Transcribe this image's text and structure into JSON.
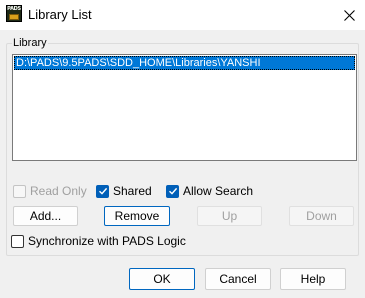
{
  "window": {
    "title": "Library List",
    "icon_text": "PADS"
  },
  "group": {
    "label": "Library"
  },
  "library_list": {
    "items": [
      "D:\\PADS\\9.5PADS\\SDD_HOME\\Libraries\\YANSHI"
    ],
    "selected_index": 0
  },
  "options": {
    "read_only": {
      "label": "Read Only",
      "checked": false,
      "enabled": false
    },
    "shared": {
      "label": "Shared",
      "checked": true,
      "enabled": true
    },
    "allow_search": {
      "label": "Allow Search",
      "checked": true,
      "enabled": true
    },
    "sync_pads_logic": {
      "label": "Synchronize with PADS Logic",
      "checked": false,
      "enabled": true
    }
  },
  "buttons": {
    "add": "Add...",
    "remove": "Remove",
    "up": "Up",
    "down": "Down",
    "ok": "OK",
    "cancel": "Cancel",
    "help": "Help"
  },
  "colors": {
    "selection": "#0078d7",
    "checkbox_checked": "#005fb8",
    "focus_border": "#0067c0"
  }
}
